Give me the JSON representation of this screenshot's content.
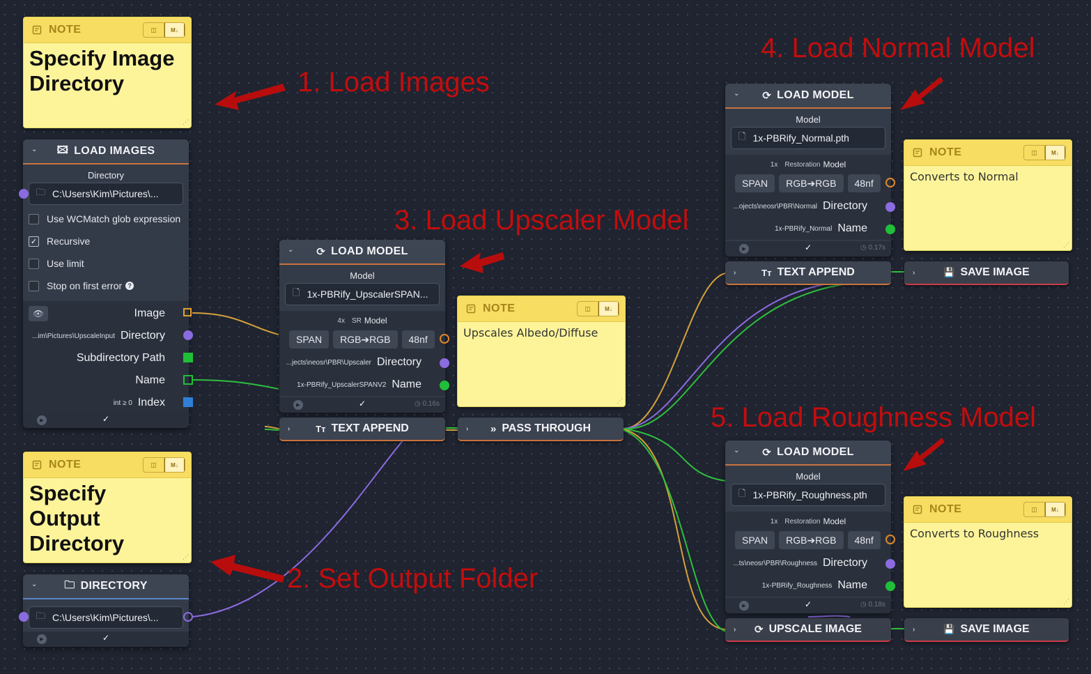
{
  "colors": {
    "background": "#1f2430",
    "note_yellow": "#fdf49a",
    "accent_orange": "#c8743e",
    "accent_red": "#cc3c48",
    "accent_blue": "#5b87c9",
    "annotation_red": "#c30d0d",
    "port_purple": "#8b6be0",
    "port_green": "#1fbf3a",
    "port_orange": "#e0882a",
    "port_blue": "#2f7fd8"
  },
  "note_common": {
    "title": "NOTE",
    "toggle_left": "◫",
    "toggle_right": "M↓"
  },
  "notes": {
    "images_dir": "Specify Image Directory",
    "output_dir": "Specify Output Directory",
    "upscale": "Upscales Albedo/Diffuse",
    "normal": "Converts to Normal",
    "roughness": "Converts to Roughness"
  },
  "load_images": {
    "title": "LOAD IMAGES",
    "directory_label": "Directory",
    "directory_value": "C:\\Users\\Kim\\Pictures\\...",
    "options": [
      {
        "label": "Use WCMatch glob expression",
        "checked": false
      },
      {
        "label": "Recursive",
        "checked": true
      },
      {
        "label": "Use limit",
        "checked": false
      },
      {
        "label": "Stop on first error",
        "checked": false
      }
    ],
    "outputs": {
      "image": "Image",
      "directory_sub": "...im\\Pictures\\UpscaleInput",
      "directory": "Directory",
      "subdirectory": "Subdirectory Path",
      "name": "Name",
      "index_sub": "int ≥ 0",
      "index": "Index"
    }
  },
  "directory_node": {
    "title": "DIRECTORY",
    "value": "C:\\Users\\Kim\\Pictures\\..."
  },
  "load_model_upscaler": {
    "title": "LOAD MODEL",
    "model_label": "Model",
    "model_value": "1x-PBRify_UpscalerSPAN...",
    "scale": "4x",
    "kind": "SR",
    "kind_label": "Model",
    "chips": [
      "SPAN",
      "RGB➔RGB",
      "48nf"
    ],
    "dir_sub": "...jects\\neosr\\PBR\\Upscaler",
    "dir_label": "Directory",
    "name_sub": "1x-PBRify_UpscalerSPANV2",
    "name_label": "Name",
    "timing": "0.16s"
  },
  "load_model_normal": {
    "title": "LOAD MODEL",
    "model_label": "Model",
    "model_value": "1x-PBRify_Normal.pth",
    "scale": "1x",
    "kind": "Restoration",
    "kind_label": "Model",
    "chips": [
      "SPAN",
      "RGB➔RGB",
      "48nf"
    ],
    "dir_sub": "...ojects\\neosr\\PBR\\Normal",
    "dir_label": "Directory",
    "name_sub": "1x-PBRify_Normal",
    "name_label": "Name",
    "timing": "0.17s"
  },
  "load_model_roughness": {
    "title": "LOAD MODEL",
    "model_label": "Model",
    "model_value": "1x-PBRify_Roughness.pth",
    "scale": "1x",
    "kind": "Restoration",
    "kind_label": "Model",
    "chips": [
      "SPAN",
      "RGB➔RGB",
      "48nf"
    ],
    "dir_sub": "...ts\\neosr\\PBR\\Roughness",
    "dir_label": "Directory",
    "name_sub": "1x-PBRify_Roughness",
    "name_label": "Name",
    "timing": "0.18s"
  },
  "bars": {
    "text_append": "TEXT APPEND",
    "pass_through": "PASS THROUGH",
    "save_image": "SAVE IMAGE",
    "upscale_image": "UPSCALE IMAGE"
  },
  "annotations": {
    "step1": "1. Load Images",
    "step2": "2. Set Output Folder",
    "step3": "3. Load Upscaler Model",
    "step4": "4. Load Normal Model",
    "step5": "5. Load Roughness Model"
  }
}
